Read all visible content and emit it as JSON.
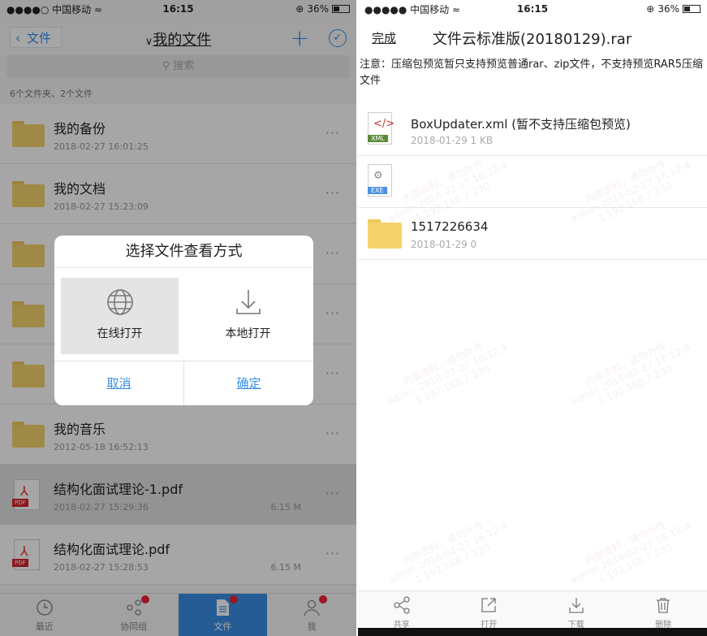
{
  "left": {
    "status": {
      "carrier": "●●●●○ 中国移动 ≈",
      "time": "16:15",
      "battery": "36%"
    },
    "nav": {
      "back": "文件",
      "title": "我的文件"
    },
    "search_placeholder": "搜索",
    "count": "6个文件夹、2个文件",
    "rows": [
      {
        "name": "我的备份",
        "time": "2018-02-27 16:01:25",
        "size": ""
      },
      {
        "name": "我的文档",
        "time": "2018-02-27 15:23:09",
        "size": ""
      },
      {
        "name": "",
        "time": "",
        "size": ""
      },
      {
        "name": "",
        "time": "",
        "size": ""
      },
      {
        "name": "",
        "time": "",
        "size": ""
      },
      {
        "name": "我的音乐",
        "time": "2012-05-18 16:52:13",
        "size": ""
      },
      {
        "name": "结构化面试理论-1.pdf",
        "time": "2018-02-27 15:29:36",
        "size": "6.15 M"
      },
      {
        "name": "结构化面试理论.pdf",
        "time": "2018-02-27 15:28:53",
        "size": "6.15 M"
      }
    ],
    "pdf_tag": "PDF",
    "more": "···",
    "dialog": {
      "title": "选择文件查看方式",
      "online": "在线打开",
      "local": "本地打开",
      "cancel": "取消",
      "confirm": "确定"
    },
    "tabs": {
      "recent": "最近",
      "group": "协同组",
      "files": "文件",
      "me": "我"
    }
  },
  "right": {
    "status": {
      "carrier": "●●●●● 中国移动 ≈",
      "time": "16:15",
      "battery": "36%"
    },
    "done": "完成",
    "title": "文件云标准版(20180129).rar",
    "notice": "注意：压缩包预览暂只支持预览普通rar、zip文件，不支持预览RAR5压缩文件",
    "rows": [
      {
        "name": "BoxUpdater.xml  (暂不支持压缩包预览)",
        "meta": "2018-01-29   1 KB",
        "tag": "XML"
      },
      {
        "name": "",
        "meta": "",
        "tag": "EXE"
      },
      {
        "name": "1517226634",
        "meta": "2018-01-29   0",
        "tag": ""
      }
    ],
    "watermark": [
      "内部资料，请勿外传",
      "admin 2018-02-27 16:12:4",
      "1.192.168.7.230"
    ],
    "toolbar": {
      "share": "共享",
      "open": "打开",
      "download": "下载",
      "delete": "删除"
    }
  }
}
